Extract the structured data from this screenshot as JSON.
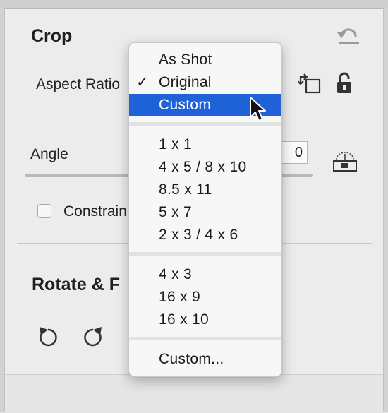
{
  "crop": {
    "title": "Crop",
    "aspect_ratio_label": "Aspect Ratio",
    "angle_label": "Angle",
    "angle_value": "0",
    "constrain_label": "Constrain"
  },
  "rotate": {
    "title": "Rotate & F"
  },
  "dropdown": {
    "items": [
      {
        "label": "As Shot"
      },
      {
        "label": "Original",
        "checked": true,
        "check": "✓"
      },
      {
        "label": "Custom",
        "highlighted": true
      }
    ],
    "group2": [
      {
        "label": "1 x 1"
      },
      {
        "label": "4 x 5 / 8 x 10"
      },
      {
        "label": "8.5 x 11"
      },
      {
        "label": "5 x 7"
      },
      {
        "label": "2 x 3 / 4 x 6"
      }
    ],
    "group3": [
      {
        "label": "4 x 3"
      },
      {
        "label": "16 x 9"
      },
      {
        "label": "16 x 10"
      }
    ],
    "group4": [
      {
        "label": "Custom..."
      }
    ]
  },
  "colors": {
    "highlight": "#1f62d8",
    "panel_bg": "#ececec",
    "menu_bg": "#f7f7f7"
  },
  "icons": [
    "reset-icon",
    "swap-orientation-icon",
    "unlock-icon",
    "level-tool-icon",
    "rotate-left-icon",
    "rotate-right-icon",
    "pointer-cursor-icon"
  ]
}
